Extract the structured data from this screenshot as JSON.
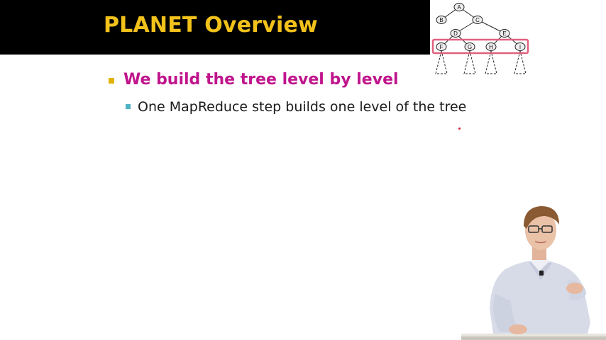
{
  "slide": {
    "title": "PLANET Overview",
    "bullets": [
      {
        "text": "We build the tree level by level",
        "level": 1,
        "color": "#c0158c"
      },
      {
        "text": "One MapReduce step builds one level of the tree",
        "level": 2
      }
    ]
  },
  "tree_diagram": {
    "nodes": [
      "A",
      "B",
      "C",
      "D",
      "E",
      "F",
      "G",
      "H",
      "I"
    ],
    "highlighted_level": [
      "F",
      "G",
      "H",
      "I"
    ],
    "highlight_color": "#e0607e"
  },
  "colors": {
    "title_bar": "#000000",
    "title_text": "#f2c21b",
    "bullet1_marker": "#e0b300",
    "bullet2_marker": "#4db3c4"
  },
  "video": {
    "presenter": "speaker-figure"
  }
}
